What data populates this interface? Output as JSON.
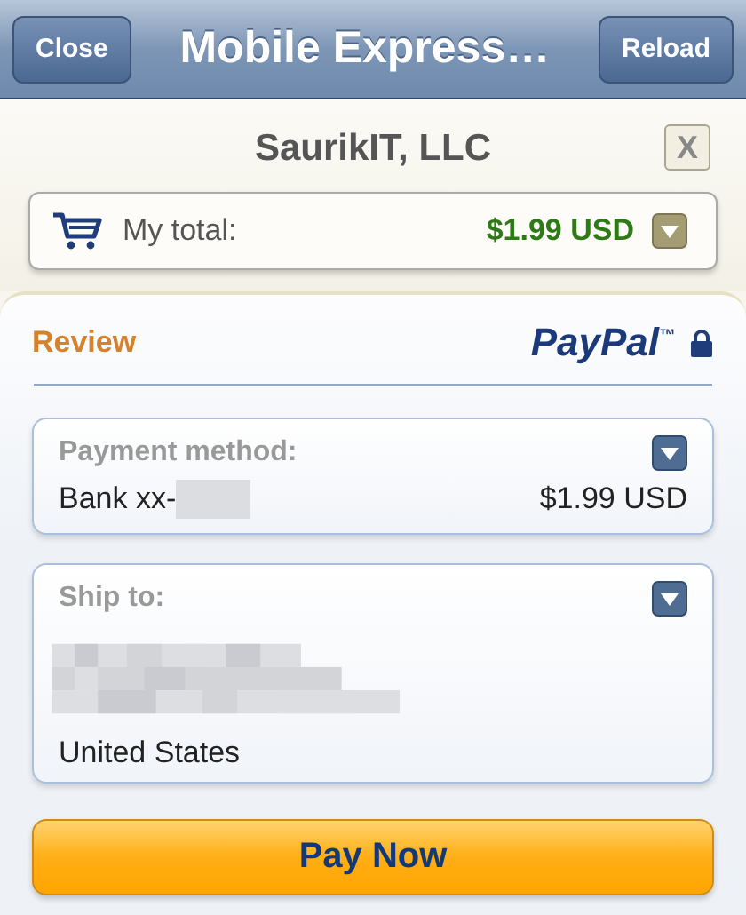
{
  "nav_bar": {
    "left_button": "Close",
    "title": "Mobile Express…",
    "right_button": "Reload"
  },
  "merchant": {
    "name": "SaurikIT, LLC",
    "close_label": "X"
  },
  "total": {
    "label": "My total:",
    "amount": "$1.99 USD"
  },
  "review": {
    "heading": "Review",
    "logo": "PayPal$^{™}$"
  },
  "payment": {
    "label": "Payment method:",
    "account": "Bank xx-",
    "amount": "$1.99 USD"
  },
  "shipping": {
    "label": "Ship to:",
    "country": "United States"
  },
  "pay_button": "Pay Now"
}
